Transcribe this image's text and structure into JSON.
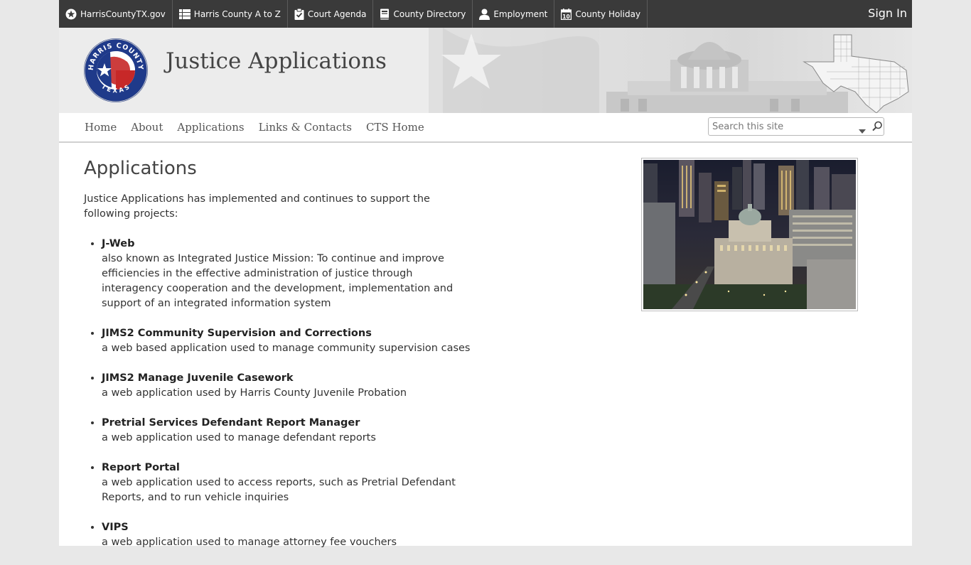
{
  "topbar": {
    "links": [
      {
        "label": "HarrisCountyTX.gov",
        "icon": "star-circle-icon"
      },
      {
        "label": "Harris County A to Z",
        "icon": "list-icon"
      },
      {
        "label": "Court Agenda",
        "icon": "clipboard-check-icon"
      },
      {
        "label": "County Directory",
        "icon": "book-icon"
      },
      {
        "label": "Employment",
        "icon": "person-icon"
      },
      {
        "label": "County Holiday",
        "icon": "calendar-icon"
      }
    ],
    "sign_in": "Sign In"
  },
  "banner": {
    "title": "Justice Applications",
    "seal_top_text": "HARRIS COUNTY",
    "seal_bottom_text": "TEXAS"
  },
  "nav": {
    "items": [
      "Home",
      "About",
      "Applications",
      "Links & Contacts",
      "CTS Home"
    ],
    "search_placeholder": "Search this site"
  },
  "main": {
    "heading": "Applications",
    "intro": "Justice Applications has implemented and continues to support the following projects:",
    "projects": [
      {
        "name": "J-Web",
        "description": "also known as Integrated Justice Mission: To continue and improve efficiencies in the effective administration of justice through interagency cooperation and the development, implementation and support of an integrated information system"
      },
      {
        "name": "JIMS2 Community Supervision and Corrections",
        "description": "a web based application used to manage community supervision cases"
      },
      {
        "name": "JIMS2 Manage Juvenile Casework",
        "description": "a web application used by Harris County Juvenile Probation"
      },
      {
        "name": "Pretrial Services Defendant Report Manager",
        "description": "a web application used to manage defendant reports"
      },
      {
        "name": "Report Portal",
        "description": "a web application used to access reports, such as Pretrial Defendant Reports, and to run vehicle inquiries"
      },
      {
        "name": "VIPS",
        "description": "a web application used to manage attorney fee vouchers"
      }
    ]
  },
  "colors": {
    "topbar_bg": "#3a3a3a",
    "page_bg": "#e8e8e8",
    "seal_blue": "#1f3a8a",
    "seal_red": "#c62828"
  }
}
